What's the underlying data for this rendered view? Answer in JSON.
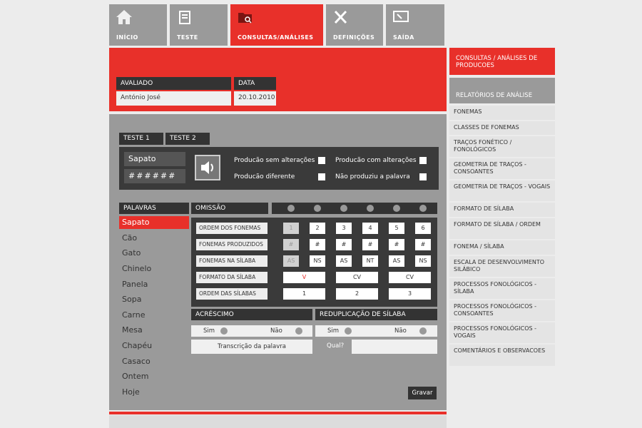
{
  "nav": {
    "tabs": [
      {
        "label": "INÍCIO",
        "icon": "home-icon"
      },
      {
        "label": "TESTE",
        "icon": "test-sheet-icon"
      },
      {
        "label": "CONSULTAS/ANÁLISES",
        "icon": "folder-search-icon"
      },
      {
        "label": "DEFINIÇÕES",
        "icon": "tools-icon"
      },
      {
        "label": "SAÍDA",
        "icon": "exit-monitor-icon"
      }
    ],
    "active": "CONSULTAS/ANÁLISES"
  },
  "header": {
    "avaliado_label": "AVALIADO",
    "avaliado_value": "António José",
    "data_label": "DATA",
    "data_value": "20.10.2010"
  },
  "tests": {
    "tab1": "TESTE 1",
    "tab2": "TESTE 2"
  },
  "word": {
    "text": "Sapato",
    "mask": "######",
    "options": [
      "Producão sem alterações",
      "Producão com alterações",
      "Producão diferente",
      "Não produziu a palavra"
    ]
  },
  "palavras": {
    "header": "PALAVRAS",
    "items": [
      "Sapato",
      "Cão",
      "Gato",
      "Chinelo",
      "Panela",
      "Sopa",
      "Carne",
      "Mesa",
      "Chapéu",
      "Casaco",
      "Ontem",
      "Hoje"
    ],
    "selected": "Sapato"
  },
  "omissao": {
    "header": "OMISSÃO",
    "rows": [
      {
        "label": "ORDEM DOS FONEMAS",
        "cells": [
          "1",
          "2",
          "3",
          "4",
          "5",
          "6"
        ]
      },
      {
        "label": "FONEMAS PRODUZIDOS",
        "cells": [
          "#",
          "#",
          "#",
          "#",
          "#",
          "#"
        ]
      },
      {
        "label": "FONEMAS NA SÍLABA",
        "cells": [
          "AS",
          "NS",
          "AS",
          "NT",
          "AS",
          "NS"
        ]
      },
      {
        "label": "FORMATO DA SÍLABA",
        "cells": [
          "V",
          "CV",
          "CV"
        ]
      },
      {
        "label": "ORDEM DAS SÍLABAS",
        "cells": [
          "1",
          "2",
          "3"
        ]
      }
    ]
  },
  "acrescimo": {
    "header": "ACRÉSCIMO",
    "sim": "Sim",
    "nao": "Não",
    "transcricao": "Transcrição da palavra"
  },
  "reduplicacao": {
    "header": "REDUPLICAÇÃO DE SÍLABA",
    "sim": "Sim",
    "nao": "Não",
    "qual_label": "Qual?",
    "qual_value": ""
  },
  "gravar_label": "Gravar",
  "sidebar": {
    "top": "CONSULTAS / ANÁLISES DE PRODUCOES",
    "header": "RELATÓRIOS DE ANÁLISE",
    "items": [
      "FONEMAS",
      "CLASSES DE FONEMAS",
      "TRAÇOS FONÉTICO / FONOLÓGICOS",
      "GEOMETRIA DE TRAÇOS - CONSOANTES",
      "GEOMETRIA DE TRAÇOS - VOGAIS",
      "FORMATO DE SÍLABA",
      "FORMATO DE SÍLABA / ORDEM",
      "FONEMA / SÍLABA",
      "ESCALA DE DESENVOLVIMENTO SILÁBICO",
      "PROCESSOS FONOLÓGICOS - SÍLABA",
      "PROCESSOS FONOLÓGICOS - CONSOANTES",
      "PROCESSOS FONOLÓGICOS - VOGAIS",
      "COMENTÁRIOS E OBSERVACOES"
    ]
  },
  "colors": {
    "accent": "#e8302a",
    "panel_dark": "#333333",
    "panel_grey": "#9a9a9a"
  }
}
